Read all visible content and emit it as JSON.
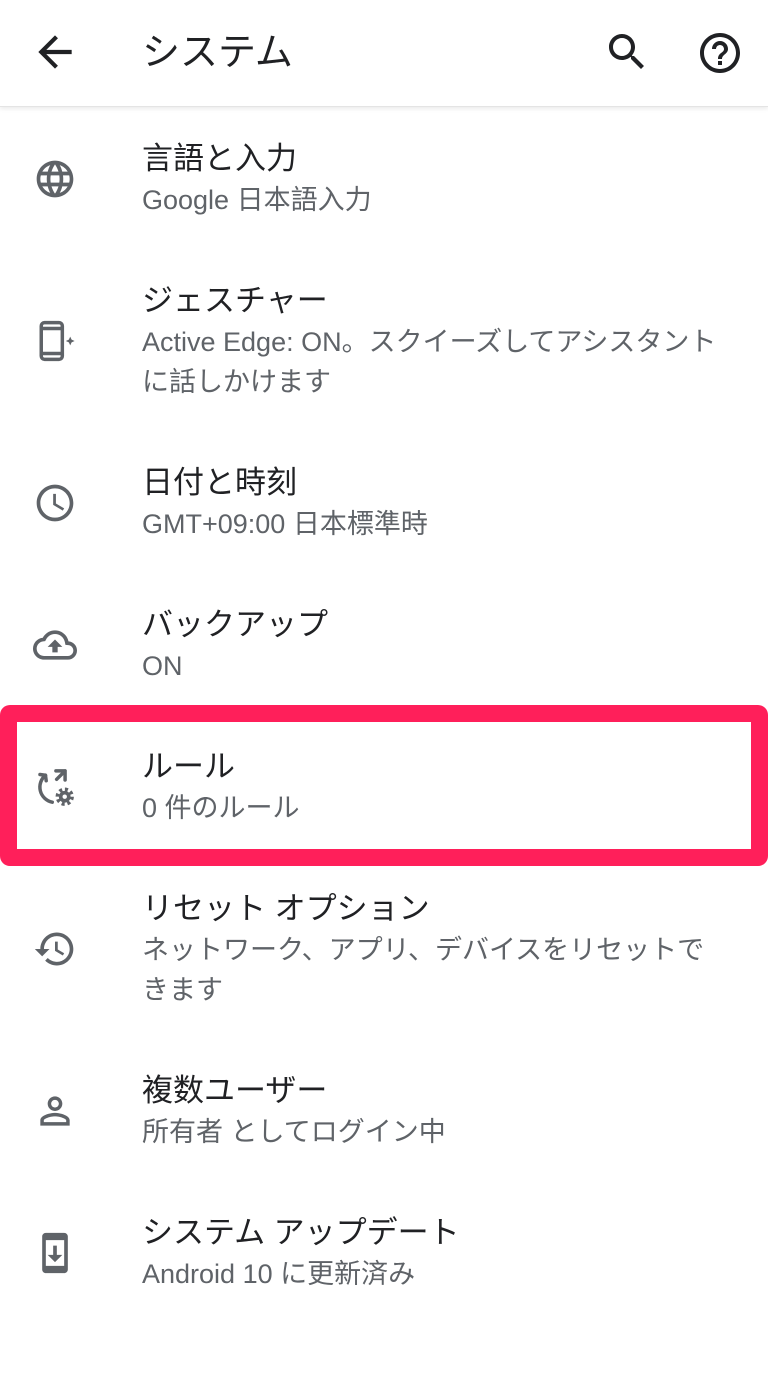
{
  "app_bar": {
    "title": "システム",
    "back_icon": "arrow-back-icon",
    "search_icon": "search-icon",
    "help_icon": "help-icon"
  },
  "settings": [
    {
      "title": "言語と入力",
      "summary": "Google 日本語入力",
      "icon": "globe-icon"
    },
    {
      "title": "ジェスチャー",
      "summary": "Active Edge: ON。スクイーズしてアシスタントに話しかけます",
      "icon": "gesture-phone-icon"
    },
    {
      "title": "日付と時刻",
      "summary": "GMT+09:00 日本標準時",
      "icon": "clock-icon"
    },
    {
      "title": "バックアップ",
      "summary": "ON",
      "icon": "cloud-upload-icon"
    },
    {
      "title": "ルール",
      "summary": "0 件のルール",
      "icon": "rules-icon"
    },
    {
      "title": "リセット オプション",
      "summary": "ネットワーク、アプリ、デバイスをリセットできます",
      "icon": "history-icon"
    },
    {
      "title": "複数ユーザー",
      "summary": "所有者 としてログイン中",
      "icon": "person-icon"
    },
    {
      "title": "システム アップデート",
      "summary": "Android 10 に更新済み",
      "icon": "system-update-icon"
    }
  ],
  "colors": {
    "background": "#ffffff",
    "app_bar_icon": "#202124",
    "title_text": "#202124",
    "summary_text": "#5f6368",
    "list_icon": "#5f6368",
    "highlight_frame": "#ff1f5a"
  }
}
